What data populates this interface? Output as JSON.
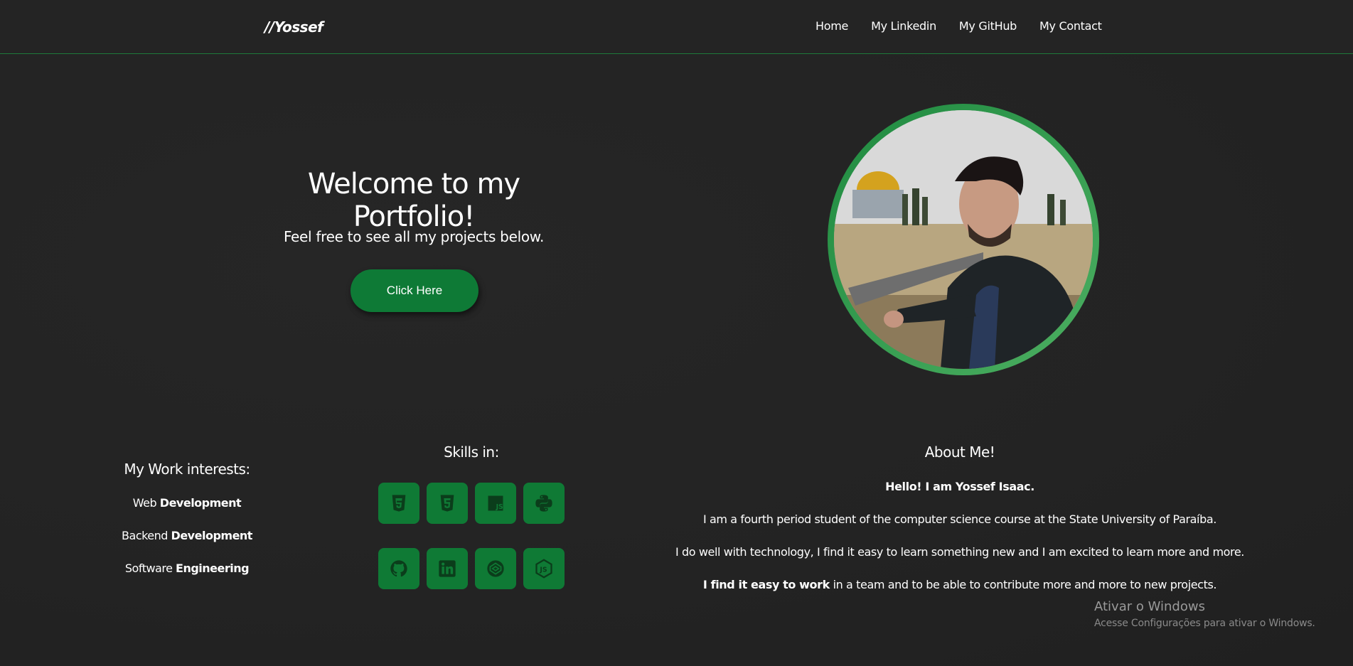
{
  "header": {
    "logo": "//Yossef",
    "nav": [
      "Home",
      "My Linkedin",
      "My GitHub",
      "My Contact"
    ]
  },
  "hero": {
    "title": "Welcome to my Portfolio!",
    "subtitle": "Feel free to see all my projects below.",
    "button_label": "Click Here"
  },
  "work_interests": {
    "title": "My Work interests:",
    "items": [
      {
        "light": "Web",
        "bold": "Development"
      },
      {
        "light": "Backend",
        "bold": "Development"
      },
      {
        "light": "Software",
        "bold": "Engineering"
      }
    ]
  },
  "skills": {
    "title": "Skills in:",
    "icons": [
      "html5-icon",
      "css3-icon",
      "javascript-icon",
      "python-icon",
      "github-icon",
      "linkedin-icon",
      "codepen-icon",
      "nodejs-icon"
    ]
  },
  "about": {
    "title": "About Me!",
    "greeting": "Hello! I am Yossef Isaac.",
    "line1": "I am a fourth period student of the computer science course at the State University of Paraíba.",
    "line2": "I do well with technology, I find it easy to learn something new and I am excited to learn more and more.",
    "line3_bold": "I find it easy to work",
    "line3_rest": " in a team and to be able to contribute more and more to new projects."
  },
  "watermark": {
    "title": "Ativar o Windows",
    "subtitle": "Acesse Configurações para ativar o Windows."
  },
  "colors": {
    "accent": "#0e7a36",
    "background": "#232323",
    "ring": "#2e9a4a"
  }
}
